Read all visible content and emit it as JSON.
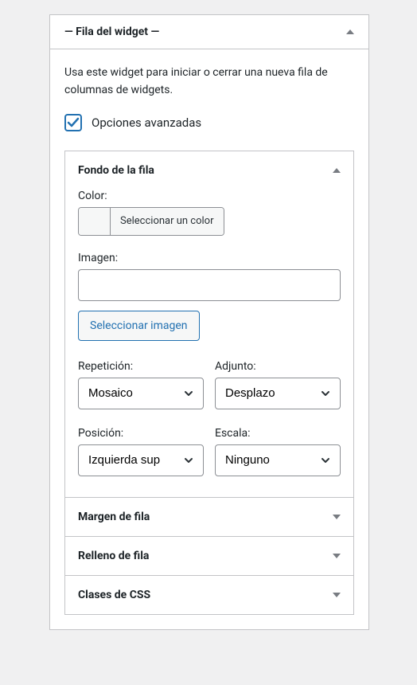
{
  "widget": {
    "title": "— Fila del widget —",
    "description": "Usa este widget para iniciar o cerrar una nueva fila de columnas de widgets.",
    "advancedOptionsLabel": "Opciones avanzadas"
  },
  "background": {
    "sectionTitle": "Fondo de la fila",
    "colorLabel": "Color:",
    "colorSelectText": "Seleccionar un color",
    "imageLabel": "Imagen:",
    "imageValue": "",
    "selectImageButton": "Seleccionar imagen",
    "repeatLabel": "Repetición:",
    "repeatValue": "Mosaico",
    "attachmentLabel": "Adjunto:",
    "attachmentValue": "Desplazo",
    "positionLabel": "Posición:",
    "positionValue": "Izquierda sup",
    "scaleLabel": "Escala:",
    "scaleValue": "Ninguno"
  },
  "sections": {
    "margin": "Margen de fila",
    "padding": "Relleno de fila",
    "cssClasses": "Clases de CSS"
  }
}
